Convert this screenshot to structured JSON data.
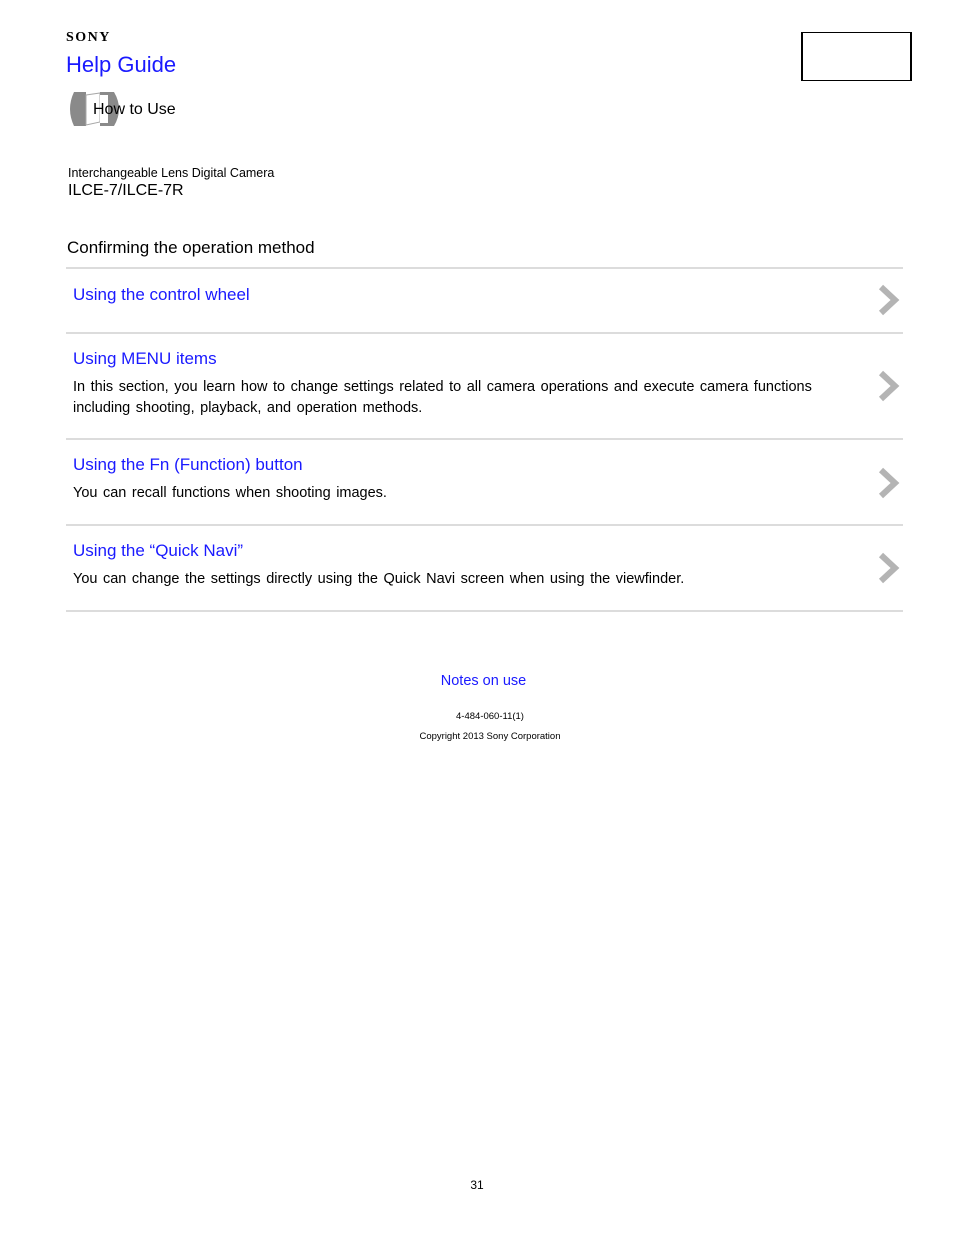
{
  "header": {
    "brand": "SONY",
    "help_guide": "Help Guide",
    "category": "How to Use",
    "category_icon": "book-icon"
  },
  "product": {
    "subtitle": "Interchangeable Lens Digital Camera",
    "model": "ILCE-7/ILCE-7R"
  },
  "section": {
    "title": "Confirming the operation method",
    "items": [
      {
        "title": "Using the control wheel",
        "description": "",
        "icon": "chevron-right-icon"
      },
      {
        "title": "Using MENU items",
        "description": "In this section, you learn how to change settings related to all camera operations and execute camera functions including shooting, playback, and operation methods.",
        "icon": "chevron-right-icon"
      },
      {
        "title": "Using the Fn (Function) button",
        "description": "You can recall functions when shooting images.",
        "icon": "chevron-right-icon"
      },
      {
        "title": "Using the “Quick Navi”",
        "description": "You can change the settings directly using the Quick Navi screen when using the viewfinder.",
        "icon": "chevron-right-icon"
      }
    ]
  },
  "footer": {
    "notes_link": "Notes on use",
    "doc_id": "4-484-060-11(1)",
    "copyright": "Copyright 2013 Sony Corporation",
    "page_number": "31"
  },
  "colors": {
    "link": "#1a1aff",
    "divider": "#dcdcdc",
    "chevron": "#b4b4b4"
  }
}
